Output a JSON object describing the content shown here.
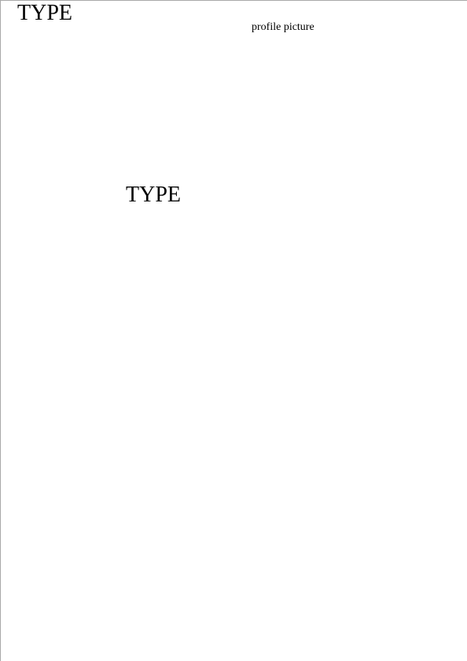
{
  "page": {
    "heading_top": "TYPE",
    "profile_caption": "profile picture",
    "heading_mid": "TYPE"
  }
}
